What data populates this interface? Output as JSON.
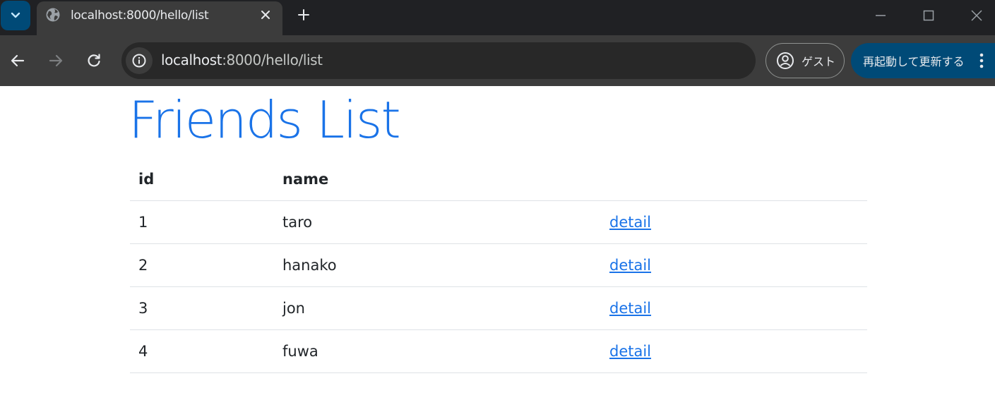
{
  "browser": {
    "tab_title": "localhost:8000/hello/list",
    "url_host": "localhost",
    "url_rest": ":8000/hello/list",
    "guest_label": "ゲスト",
    "relaunch_label": "再起動して更新する"
  },
  "page": {
    "heading": "Friends List",
    "table": {
      "headers": {
        "id": "id",
        "name": "name",
        "link": ""
      },
      "rows": [
        {
          "id": "1",
          "name": "taro",
          "link": "detail"
        },
        {
          "id": "2",
          "name": "hanako",
          "link": "detail"
        },
        {
          "id": "3",
          "name": "jon",
          "link": "detail"
        },
        {
          "id": "4",
          "name": "fuwa",
          "link": "detail"
        }
      ]
    }
  },
  "colors": {
    "accent": "#1a73e8",
    "chrome_dark": "#202124",
    "toolbar": "#3c3c3c",
    "relaunch_bg": "#004a77"
  }
}
